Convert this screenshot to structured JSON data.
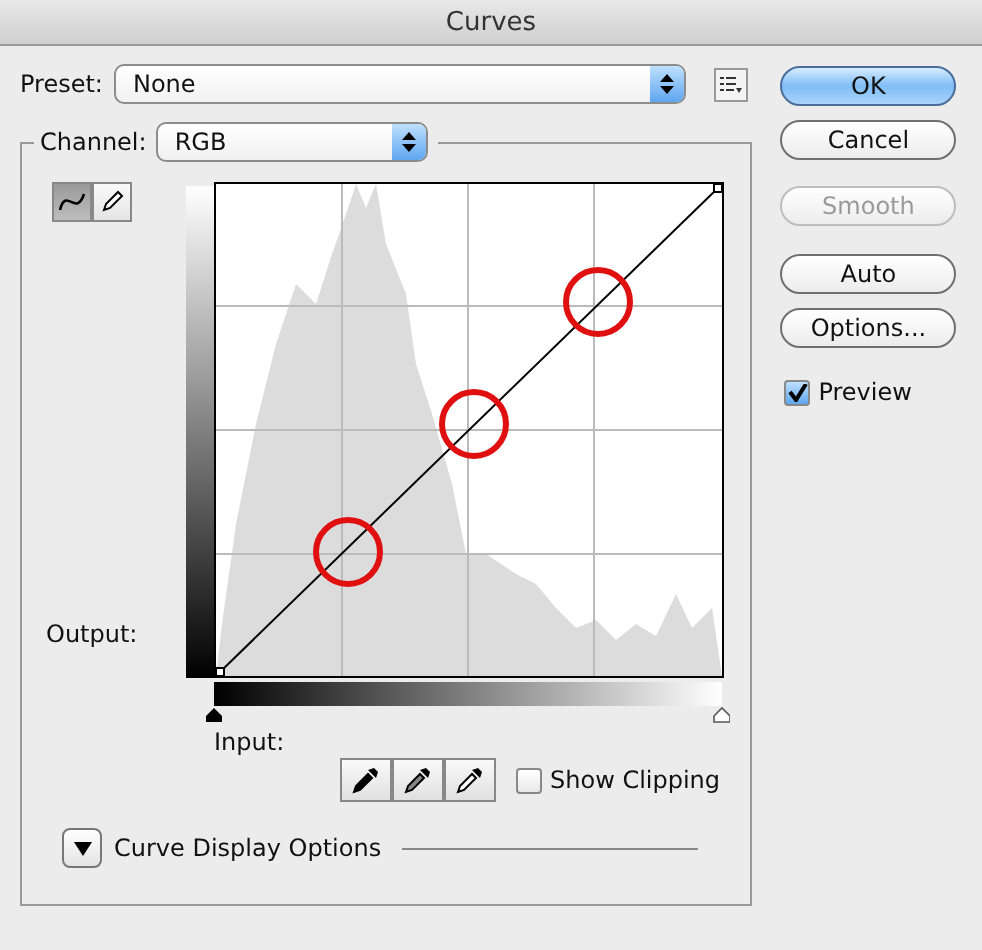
{
  "window": {
    "title": "Curves"
  },
  "preset": {
    "label": "Preset:",
    "value": "None"
  },
  "channel": {
    "label": "Channel:",
    "value": "RGB"
  },
  "curve_tools": [
    {
      "kind": "curve",
      "selected": true
    },
    {
      "kind": "pencil",
      "selected": false
    }
  ],
  "output_label": "Output:",
  "input_label": "Input:",
  "show_clipping": {
    "label": "Show Clipping",
    "checked": false
  },
  "curve_display_options": {
    "label": "Curve Display Options",
    "expanded": false
  },
  "buttons": [
    {
      "label": "OK",
      "kind": "default",
      "disabled": false
    },
    {
      "label": "Cancel",
      "kind": "normal",
      "disabled": false
    },
    {
      "label": "Smooth",
      "kind": "normal",
      "disabled": true
    },
    {
      "label": "Auto",
      "kind": "normal",
      "disabled": false
    },
    {
      "label": "Options...",
      "kind": "normal",
      "disabled": false
    }
  ],
  "preview": {
    "label": "Preview",
    "checked": true
  }
}
